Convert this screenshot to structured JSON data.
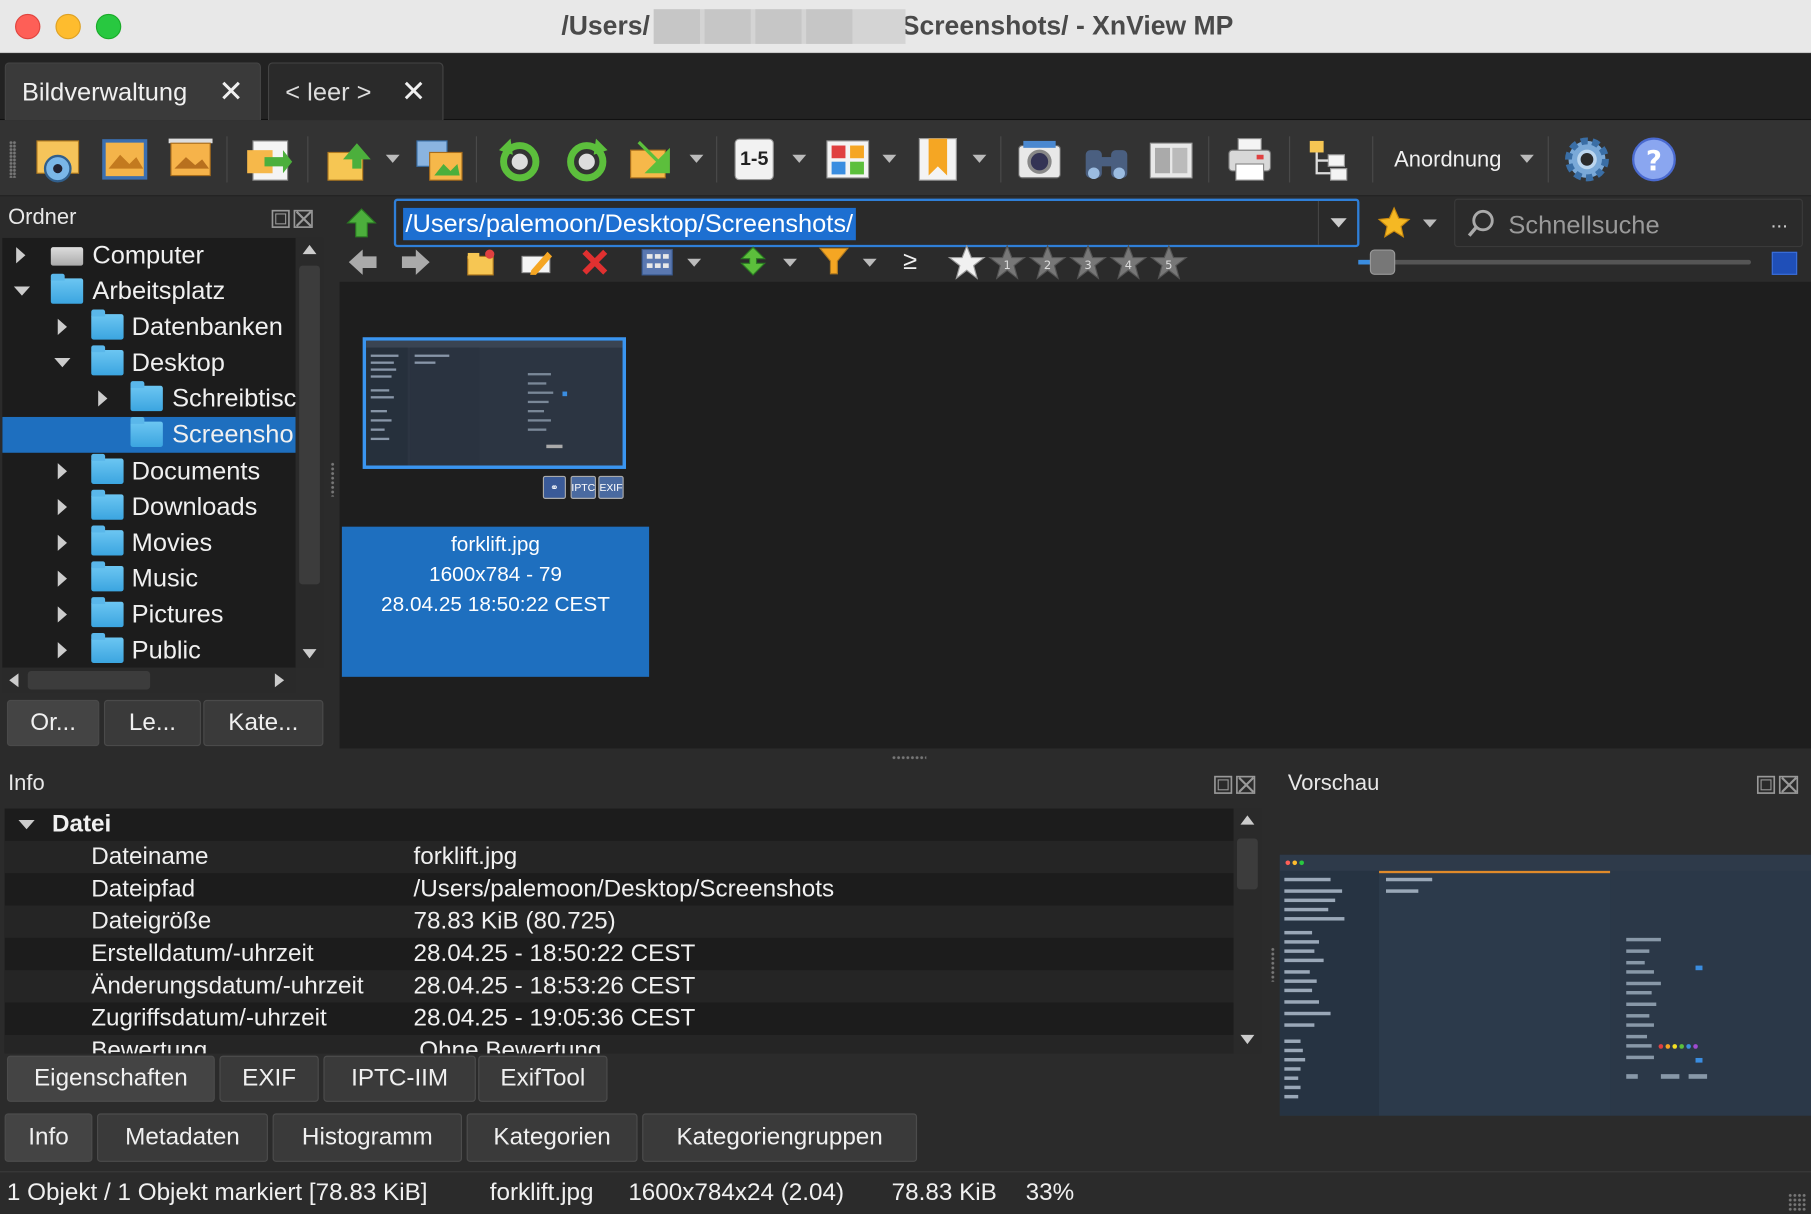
{
  "window": {
    "title_prefix": "/Users/",
    "title_suffix": "Screenshots/ - XnView MP"
  },
  "doc_tabs": [
    {
      "label": "Bildverwaltung",
      "close": "✕"
    },
    {
      "label": "< leer >",
      "close": "✕"
    }
  ],
  "toolbar": {
    "arrange_label": "Anordnung",
    "icons": [
      "viewer-icon",
      "fullscreen-icon",
      "slideshow-icon",
      "import-icon",
      "export-icon",
      "convert-icon",
      "rotate-left-icon",
      "rotate-right-icon",
      "batch-icon",
      "number-icon",
      "thumbnail-view-icon",
      "bookmark-icon",
      "capture-icon",
      "find-icon",
      "compare-icon",
      "print-icon",
      "file-list-icon",
      "settings-icon",
      "help-icon"
    ],
    "number_label": "1-5"
  },
  "folders_panel": {
    "title": "Ordner",
    "items": [
      {
        "label": "Computer",
        "icon": "drive-icon",
        "expanded": false
      },
      {
        "label": "Arbeitsplatz",
        "icon": "home-folder-icon",
        "expanded": true
      },
      {
        "label": "Datenbanken",
        "icon": "folder-icon",
        "expanded": false
      },
      {
        "label": "Desktop",
        "icon": "folder-icon",
        "expanded": true
      },
      {
        "label": "Schreibtisc",
        "icon": "folder-icon",
        "expanded": false
      },
      {
        "label": "Screensho",
        "icon": "folder-icon",
        "selected": true
      },
      {
        "label": "Documents",
        "icon": "folder-icon",
        "expanded": false
      },
      {
        "label": "Downloads",
        "icon": "folder-icon",
        "expanded": false
      },
      {
        "label": "Movies",
        "icon": "folder-icon",
        "expanded": false
      },
      {
        "label": "Music",
        "icon": "folder-icon",
        "expanded": false
      },
      {
        "label": "Pictures",
        "icon": "folder-icon",
        "expanded": false
      },
      {
        "label": "Public",
        "icon": "folder-icon",
        "expanded": false
      }
    ],
    "tabs": [
      "Or...",
      "Le...",
      "Kate..."
    ]
  },
  "address": {
    "path": "/Users/palemoon/Desktop/Screenshots/",
    "search_placeholder": "Schnellsuche",
    "search_more": "..."
  },
  "filter_bar": {
    "gte_label": "≥",
    "star_numbers": [
      "1",
      "2",
      "3",
      "4",
      "5"
    ]
  },
  "thumbnail": {
    "filename": "forklift.jpg",
    "dims": "1600x784 - 79",
    "date": "28.04.25 18:50:22 CEST",
    "badges": [
      "IPTC",
      "EXIF"
    ]
  },
  "info_panel": {
    "title": "Info",
    "group": "Datei",
    "rows": [
      {
        "key": "Dateiname",
        "value": "forklift.jpg"
      },
      {
        "key": "Dateipfad",
        "value": "/Users/palemoon/Desktop/Screenshots"
      },
      {
        "key": "Dateigröße",
        "value": "78.83 KiB (80.725)"
      },
      {
        "key": "Erstelldatum/-uhrzeit",
        "value": "28.04.25 - 18:50:22 CEST"
      },
      {
        "key": "Änderungsdatum/-uhrzeit",
        "value": "28.04.25 - 18:53:26 CEST"
      },
      {
        "key": "Zugriffsdatum/-uhrzeit",
        "value": "28.04.25 - 19:05:36 CEST"
      },
      {
        "key": "Bewertung",
        "value": "Ohne Bewertung"
      }
    ],
    "sub_tabs": [
      "Eigenschaften",
      "EXIF",
      "IPTC-IIM",
      "ExifTool"
    ],
    "main_tabs": [
      "Info",
      "Metadaten",
      "Histogramm",
      "Kategorien",
      "Kategoriengruppen"
    ]
  },
  "preview_panel": {
    "title": "Vorschau"
  },
  "status": {
    "objects": "1 Objekt / 1 Objekt markiert [78.83 KiB]",
    "filename": "forklift.jpg",
    "dims": "1600x784x24 (2.04)",
    "size": "78.83 KiB",
    "zoom": "33%"
  },
  "colors": {
    "selection": "#1e6fbf",
    "accent": "#2f7fd8"
  }
}
